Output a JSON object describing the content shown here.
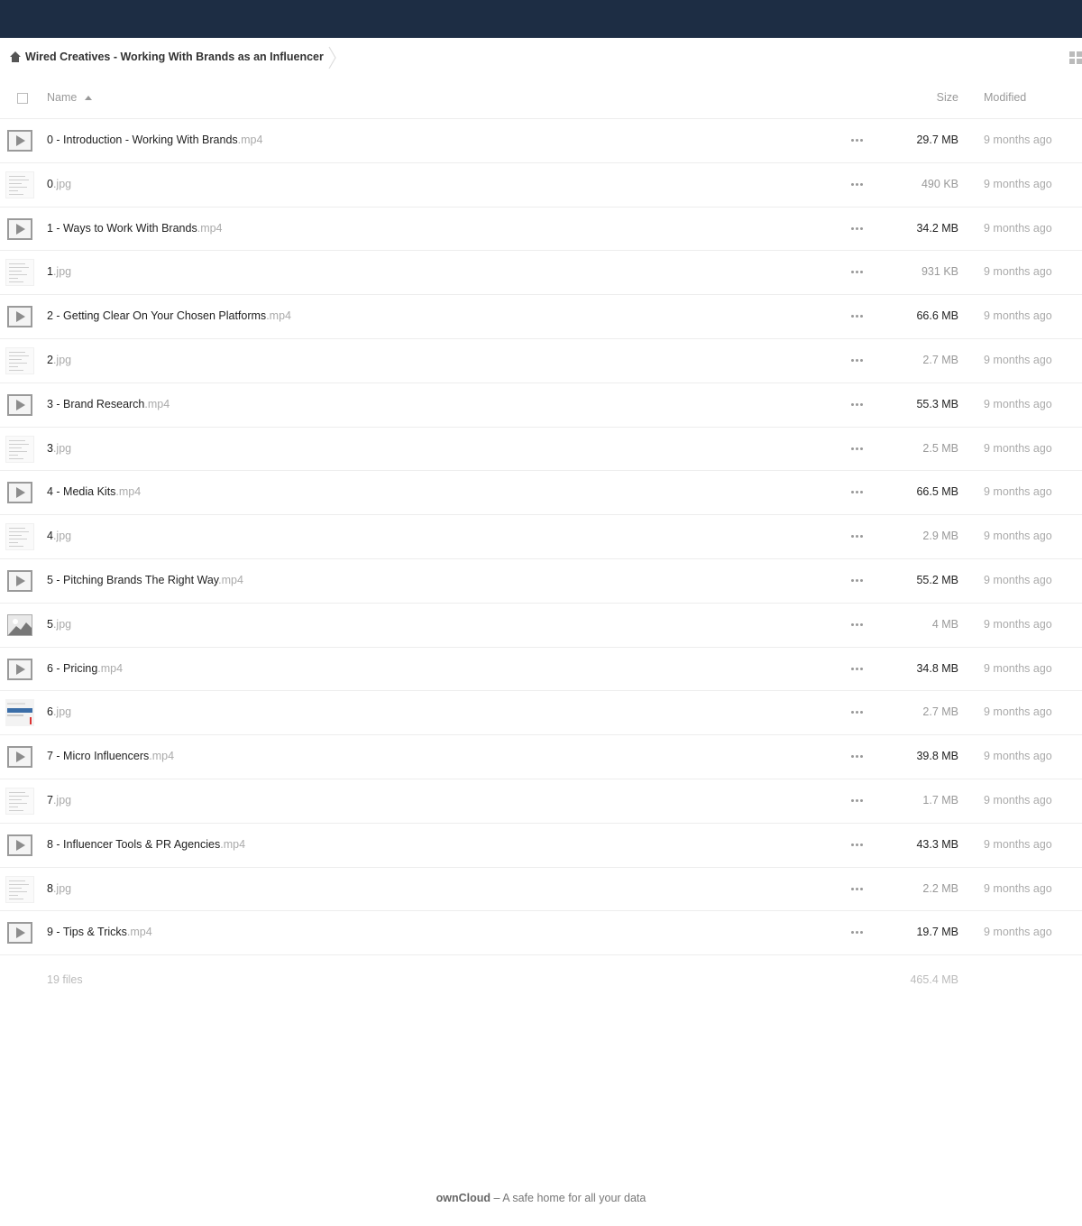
{
  "breadcrumb": {
    "label": "Wired Creatives - Working With Brands as an Influencer"
  },
  "columns": {
    "name": "Name",
    "size": "Size",
    "modified": "Modified"
  },
  "files": [
    {
      "base": "0 - Introduction - Working With Brands",
      "ext": ".mp4",
      "type": "video",
      "size": "29.7 MB",
      "modified": "9 months ago"
    },
    {
      "base": "0",
      "ext": ".jpg",
      "type": "doc",
      "size": "490 KB",
      "modified": "9 months ago"
    },
    {
      "base": "1 - Ways to Work With Brands",
      "ext": ".mp4",
      "type": "video",
      "size": "34.2 MB",
      "modified": "9 months ago"
    },
    {
      "base": "1",
      "ext": ".jpg",
      "type": "doc",
      "size": "931 KB",
      "modified": "9 months ago"
    },
    {
      "base": "2 - Getting Clear On Your Chosen Platforms",
      "ext": ".mp4",
      "type": "video",
      "size": "66.6 MB",
      "modified": "9 months ago"
    },
    {
      "base": "2",
      "ext": ".jpg",
      "type": "doc",
      "size": "2.7 MB",
      "modified": "9 months ago"
    },
    {
      "base": "3 - Brand Research",
      "ext": ".mp4",
      "type": "video",
      "size": "55.3 MB",
      "modified": "9 months ago"
    },
    {
      "base": "3",
      "ext": ".jpg",
      "type": "doc",
      "size": "2.5 MB",
      "modified": "9 months ago"
    },
    {
      "base": "4 - Media Kits",
      "ext": ".mp4",
      "type": "video",
      "size": "66.5 MB",
      "modified": "9 months ago"
    },
    {
      "base": "4",
      "ext": ".jpg",
      "type": "doc",
      "size": "2.9 MB",
      "modified": "9 months ago"
    },
    {
      "base": "5 - Pitching Brands The Right Way",
      "ext": ".mp4",
      "type": "video",
      "size": "55.2 MB",
      "modified": "9 months ago"
    },
    {
      "base": "5",
      "ext": ".jpg",
      "type": "pic",
      "size": "4 MB",
      "modified": "9 months ago"
    },
    {
      "base": "6 - Pricing",
      "ext": ".mp4",
      "type": "video",
      "size": "34.8 MB",
      "modified": "9 months ago"
    },
    {
      "base": "6",
      "ext": ".jpg",
      "type": "shot",
      "size": "2.7 MB",
      "modified": "9 months ago"
    },
    {
      "base": "7 - Micro Influencers",
      "ext": ".mp4",
      "type": "video",
      "size": "39.8 MB",
      "modified": "9 months ago"
    },
    {
      "base": "7",
      "ext": ".jpg",
      "type": "doc",
      "size": "1.7 MB",
      "modified": "9 months ago"
    },
    {
      "base": "8 - Influencer Tools & PR Agencies",
      "ext": ".mp4",
      "type": "video",
      "size": "43.3 MB",
      "modified": "9 months ago"
    },
    {
      "base": "8",
      "ext": ".jpg",
      "type": "doc",
      "size": "2.2 MB",
      "modified": "9 months ago"
    },
    {
      "base": "9 - Tips & Tricks",
      "ext": ".mp4",
      "type": "video",
      "size": "19.7 MB",
      "modified": "9 months ago"
    }
  ],
  "summary": {
    "count": "19 files",
    "total": "465.4 MB"
  },
  "footer": {
    "brand": "ownCloud",
    "tagline": " – A safe home for all your data"
  },
  "colors": {
    "topbar": "#1d2d44",
    "size_large": "#222222",
    "size_small": "#999999"
  }
}
